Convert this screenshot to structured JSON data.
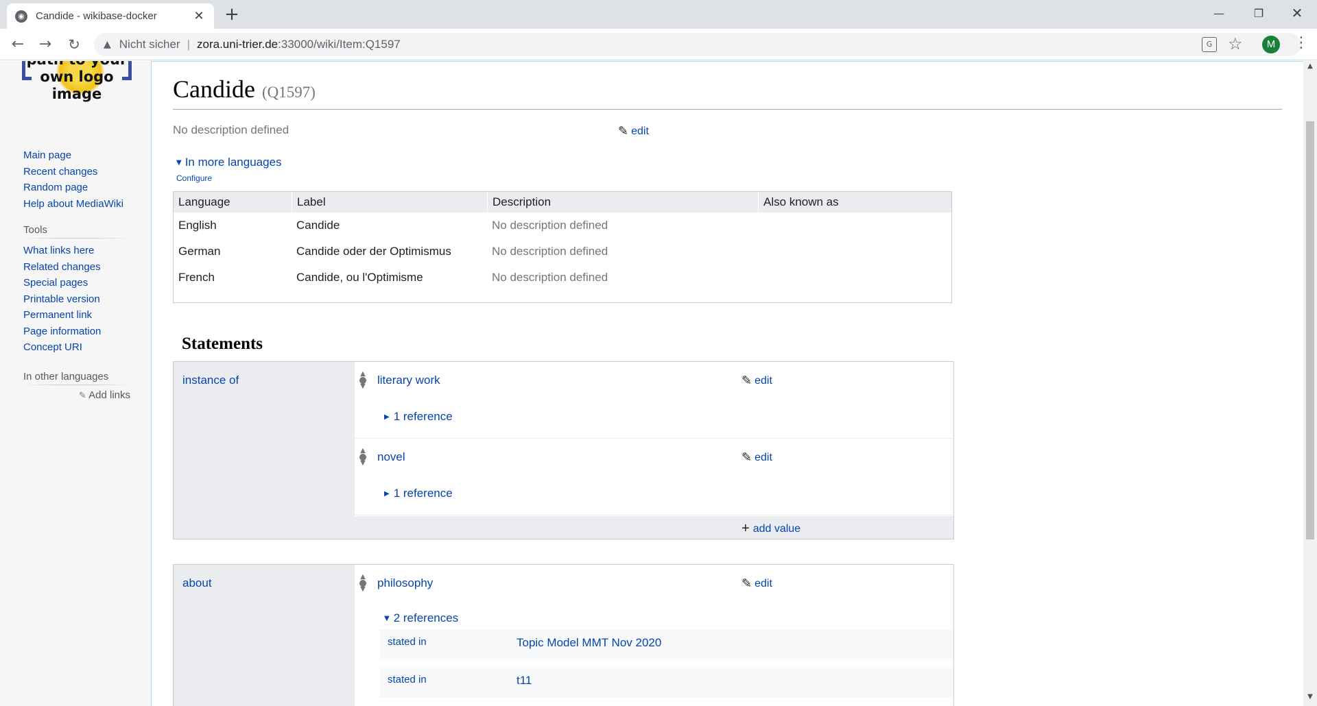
{
  "browser": {
    "tab_title": "Candide - wikibase-docker",
    "tab_close": "✕",
    "new_tab": "+",
    "win_min": "—",
    "win_max": "❐",
    "win_close": "✕",
    "back": "←",
    "forward": "→",
    "reload": "↻",
    "insecure_label": "Nicht sicher",
    "url_host": "zora.uni-trier.de",
    "url_path": ":33000/wiki/Item:Q1597",
    "profile_initial": "M",
    "icons": [
      "globe-icon",
      "warning-icon",
      "translate-icon",
      "star-icon",
      "kebab-menu-icon"
    ]
  },
  "logo": {
    "text": "path to your own logo image"
  },
  "sidebar": {
    "navigation": [
      "Main page",
      "Recent changes",
      "Random page",
      "Help about MediaWiki"
    ],
    "tools_heading": "Tools",
    "tools": [
      "What links here",
      "Related changes",
      "Special pages",
      "Printable version",
      "Permanent link",
      "Page information",
      "Concept URI"
    ],
    "languages_heading": "In other languages",
    "add_links": "Add links"
  },
  "item": {
    "label": "Candide",
    "id": "(Q1597)",
    "description": "No description defined",
    "edit": "edit",
    "more_languages": "In more languages",
    "configure": "Configure"
  },
  "lang_table": {
    "headers": [
      "Language",
      "Label",
      "Description",
      "Also known as"
    ],
    "rows": [
      {
        "language": "English",
        "label": "Candide",
        "description": "No description defined",
        "aliases": ""
      },
      {
        "language": "German",
        "label": "Candide oder der Optimismus",
        "description": "No description defined",
        "aliases": ""
      },
      {
        "language": "French",
        "label": "Candide, ou l'Optimisme",
        "description": "No description defined",
        "aliases": ""
      }
    ]
  },
  "statements": {
    "heading": "Statements",
    "groups": [
      {
        "property": "instance of",
        "values": [
          {
            "value": "literary work",
            "edit": "edit",
            "references": "1 reference"
          },
          {
            "value": "novel",
            "edit": "edit",
            "references": "1 reference"
          }
        ],
        "add_value": "add value"
      },
      {
        "property": "about",
        "values": [
          {
            "value": "philosophy",
            "edit": "edit",
            "references": "2 references",
            "reference_rows": [
              {
                "property": "stated in",
                "value": "Topic Model MMT Nov 2020"
              },
              {
                "property": "stated in",
                "value": "t11"
              }
            ]
          }
        ]
      }
    ]
  },
  "colors": {
    "link": "#0645ad",
    "muted": "#72777d",
    "table_header": "#eaecf0",
    "profile": "#188038"
  }
}
